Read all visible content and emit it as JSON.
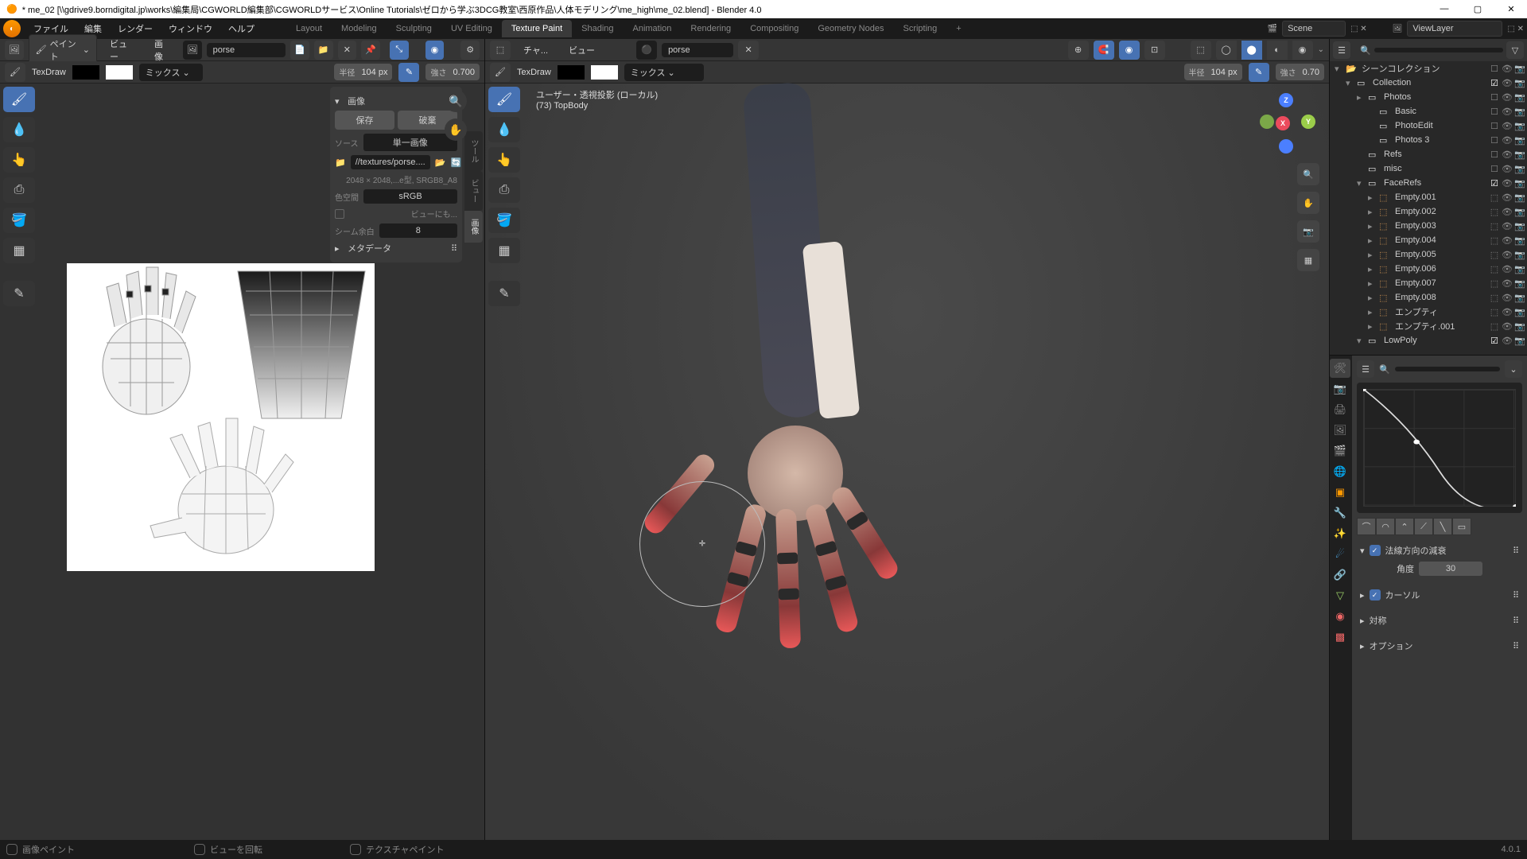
{
  "titlebar": {
    "icon": "🟠",
    "title": "* me_02 [\\\\gdrive9.borndigital.jp\\works\\編集局\\CGWORLD編集部\\CGWORLDサービス\\Online Tutorials\\ゼロから学ぶ3DCG教室\\西原作品\\人体モデリング\\me_high\\me_02.blend] - Blender 4.0"
  },
  "menubar": {
    "items": [
      "ファイル",
      "編集",
      "レンダー",
      "ウィンドウ",
      "ヘルプ"
    ]
  },
  "workspaces": {
    "tabs": [
      "Layout",
      "Modeling",
      "Sculpting",
      "UV Editing",
      "Texture Paint",
      "Shading",
      "Animation",
      "Rendering",
      "Compositing",
      "Geometry Nodes",
      "Scripting"
    ],
    "active": 4,
    "add": "+"
  },
  "scene": {
    "scene_label": "Scene",
    "viewlayer_label": "ViewLayer"
  },
  "left_editor": {
    "mode": "ペイント",
    "view": "ビュー",
    "image_menu": "画像",
    "image_name": "porse",
    "brush_label": "TexDraw",
    "blend": "ミックス",
    "radius_label": "半径",
    "radius_value": "104 px",
    "strength_label": "強さ",
    "strength_value": "0.700",
    "side_panel": {
      "image_hdr": "画像",
      "save": "保存",
      "discard": "破棄",
      "source_label": "ソース",
      "source_value": "単一画像",
      "filepath": "//textures/porse....",
      "dimensions": "2048 × 2048,...e型, SRGB8_A8",
      "colorspace_label": "色空間",
      "colorspace_value": "sRGB",
      "view_as_render": "ビューにも...",
      "seam_label": "シーム余白",
      "seam_value": "8",
      "metadata_hdr": "メタデータ"
    }
  },
  "mid_editor": {
    "char_menu": "チャ...",
    "view": "ビュー",
    "image_name": "porse",
    "brush_label": "TexDraw",
    "blend": "ミックス",
    "radius_label": "半径",
    "radius_value": "104 px",
    "strength_label": "強さ",
    "strength_value": "0.70",
    "overlay_line1": "ユーザー・透視投影 (ローカル)",
    "overlay_line2": "(73) TopBody"
  },
  "outliner": {
    "header_title": "シーンコレクション",
    "tree": [
      {
        "indent": 0,
        "icon": "▾",
        "type": "scene",
        "label": "シーンコレクション"
      },
      {
        "indent": 1,
        "icon": "▾",
        "type": "collection",
        "label": "Collection",
        "check": true
      },
      {
        "indent": 2,
        "icon": "▸",
        "type": "collection",
        "label": "Photos"
      },
      {
        "indent": 3,
        "icon": "",
        "type": "collection",
        "label": "Basic"
      },
      {
        "indent": 3,
        "icon": "",
        "type": "collection",
        "label": "PhotoEdit"
      },
      {
        "indent": 3,
        "icon": "",
        "type": "collection",
        "label": "Photos 3"
      },
      {
        "indent": 2,
        "icon": "",
        "type": "collection",
        "label": "Refs"
      },
      {
        "indent": 2,
        "icon": "",
        "type": "collection",
        "label": "misc"
      },
      {
        "indent": 2,
        "icon": "▾",
        "type": "collection",
        "label": "FaceRefs",
        "check": true
      },
      {
        "indent": 3,
        "icon": "▸",
        "type": "empty",
        "label": "Empty.001"
      },
      {
        "indent": 3,
        "icon": "▸",
        "type": "empty",
        "label": "Empty.002"
      },
      {
        "indent": 3,
        "icon": "▸",
        "type": "empty",
        "label": "Empty.003"
      },
      {
        "indent": 3,
        "icon": "▸",
        "type": "empty",
        "label": "Empty.004"
      },
      {
        "indent": 3,
        "icon": "▸",
        "type": "empty",
        "label": "Empty.005"
      },
      {
        "indent": 3,
        "icon": "▸",
        "type": "empty",
        "label": "Empty.006"
      },
      {
        "indent": 3,
        "icon": "▸",
        "type": "empty",
        "label": "Empty.007"
      },
      {
        "indent": 3,
        "icon": "▸",
        "type": "empty",
        "label": "Empty.008"
      },
      {
        "indent": 3,
        "icon": "▸",
        "type": "empty",
        "label": "エンプティ"
      },
      {
        "indent": 3,
        "icon": "▸",
        "type": "empty",
        "label": "エンプティ.001"
      },
      {
        "indent": 2,
        "icon": "▾",
        "type": "collection",
        "label": "LowPoly",
        "check": true
      }
    ]
  },
  "properties": {
    "normal_falloff": "法線方向の減衰",
    "angle_label": "角度",
    "angle_value": "30",
    "cursor": "カーソル",
    "symmetry": "対称",
    "options": "オプション"
  },
  "statusbar": {
    "item1": "画像ペイント",
    "item2": "ビューを回転",
    "item3": "テクスチャペイント",
    "version": "4.0.1"
  }
}
